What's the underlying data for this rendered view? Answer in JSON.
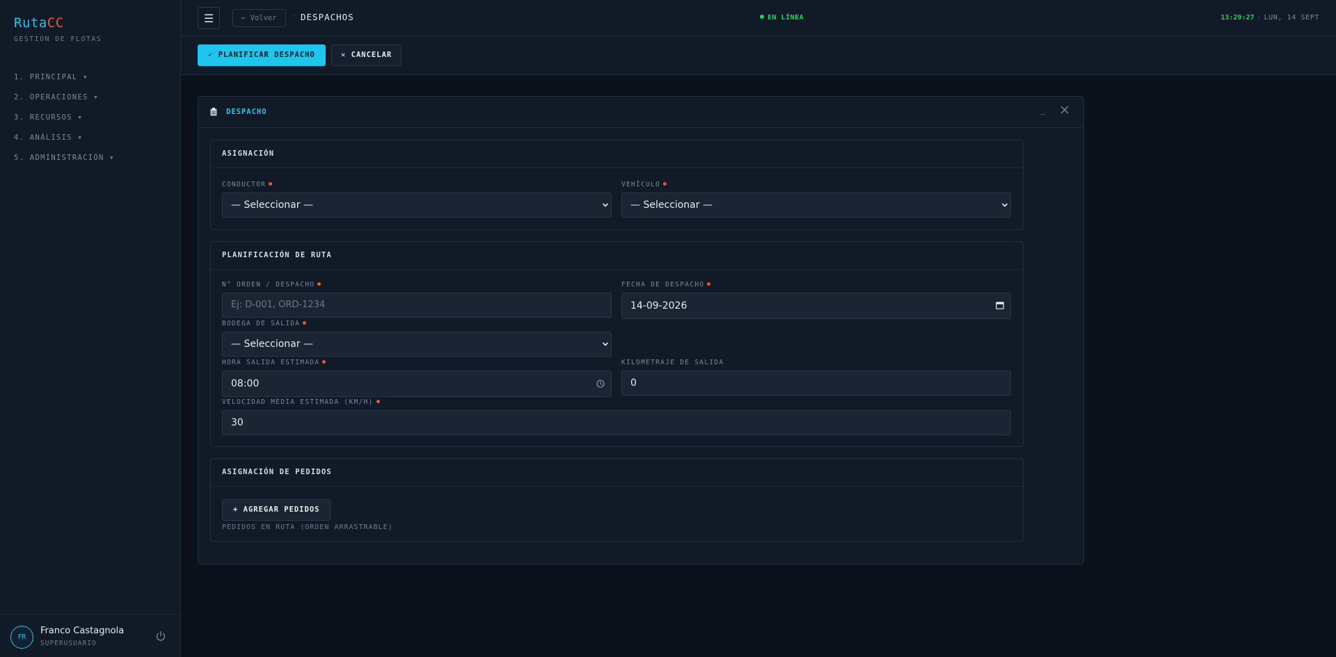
{
  "app": {
    "brand_part1": "Ruta",
    "brand_part2": "CC",
    "brand_subtitle": "GESTIÓN DE FLOTAS"
  },
  "sidebar": {
    "items": [
      {
        "label": "1. PRINCIPAL ▾"
      },
      {
        "label": "2. OPERACIONES ▾"
      },
      {
        "label": "3. RECURSOS ▾"
      },
      {
        "label": "4. ANÁLISIS ▾"
      },
      {
        "label": "5. ADMINISTRACIÓN ▾"
      }
    ],
    "user": {
      "initials": "FR",
      "name": "Franco Castagnola",
      "role": "SUPERUSUARIO"
    }
  },
  "topbar": {
    "menu_icon": "☰",
    "back_label": "← Volver",
    "breadcrumb_sep": "·",
    "breadcrumb": "DESPACHOS",
    "status": "EN LÍNEA",
    "time": "13:29:27",
    "clock_sep": "·",
    "date": "LUN, 14 SEPT"
  },
  "actions": {
    "primary": "✓ PLANIFICAR DESPACHO",
    "cancel": "✕ CANCELAR"
  },
  "modal": {
    "title": "DESPACHO",
    "minimize": "_",
    "sections": {
      "asignacion": {
        "title": "ASIGNACIÓN",
        "conductor_label": "CONDUCTOR",
        "conductor_value": "— Seleccionar —",
        "vehiculo_label": "VEHÍCULO",
        "vehiculo_value": "— Seleccionar —"
      },
      "ruta": {
        "title": "PLANIFICACIÓN DE RUTA",
        "orden_label": "N° ORDEN / DESPACHO",
        "orden_placeholder": "Ej: D-001, ORD-1234",
        "fecha_label": "FECHA DE DESPACHO",
        "fecha_value": "14-09-2026",
        "bodega_label": "BODEGA DE SALIDA",
        "bodega_value": "— Seleccionar —",
        "hora_label": "HORA SALIDA ESTIMADA",
        "hora_value": "08:00",
        "km_label": "KILOMETRAJE DE SALIDA",
        "km_value": "0",
        "velocidad_label": "VELOCIDAD MEDIA ESTIMADA (KM/H)",
        "velocidad_value": "30"
      },
      "pedidos": {
        "title": "ASIGNACIÓN DE PEDIDOS",
        "add_label": "+ AGREGAR PEDIDOS",
        "hint": "PEDIDOS EN RUTA (ORDEN ARRASTRABLE)"
      }
    }
  },
  "colors": {
    "accent": "#1fc5ec",
    "brand_alt": "#f0562e",
    "status_ok": "#22d35b",
    "background": "#0b111b",
    "panel": "#111a27"
  }
}
